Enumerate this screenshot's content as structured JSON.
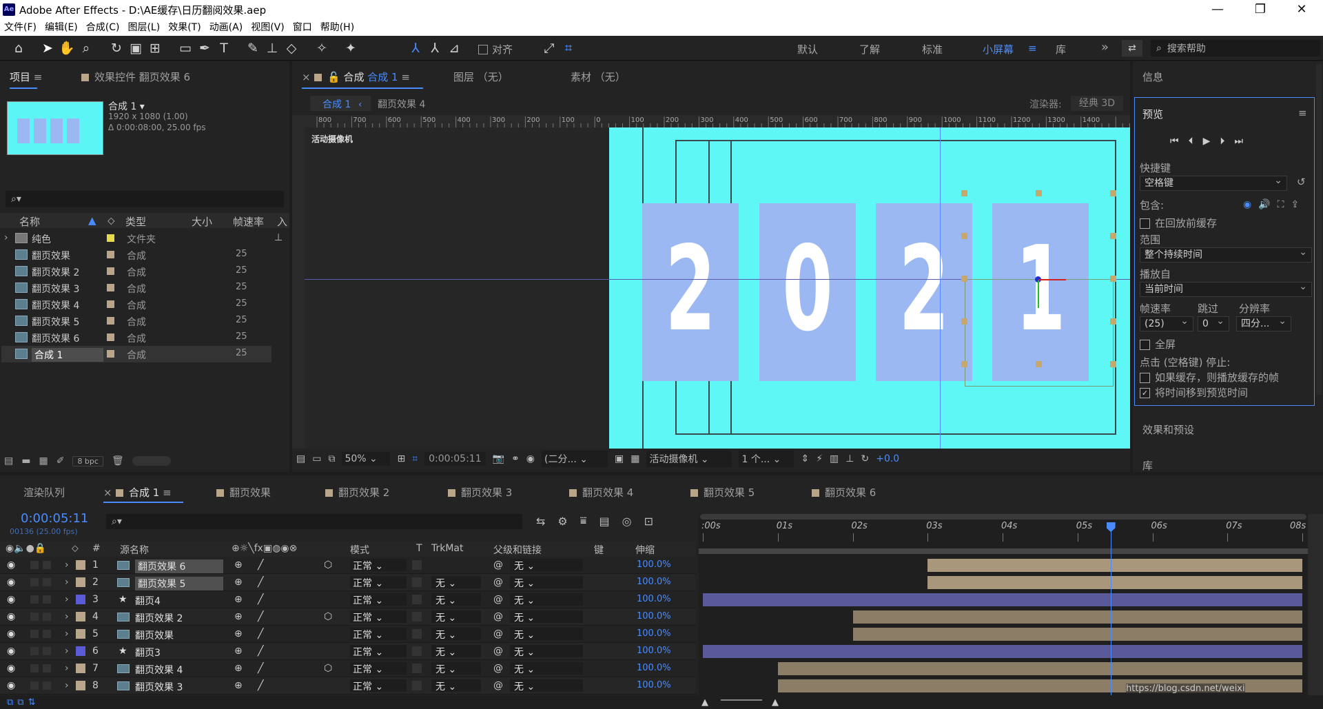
{
  "window": {
    "logo": "Ae",
    "title": "Adobe After Effects - D:\\AE缓存\\日历翻阅效果.aep",
    "minimize": "—",
    "maximize": "❐",
    "close": "✕"
  },
  "menu": [
    "文件(F)",
    "编辑(E)",
    "合成(C)",
    "图层(L)",
    "效果(T)",
    "动画(A)",
    "视图(V)",
    "窗口",
    "帮助(H)"
  ],
  "toolbar": {
    "align_label": "对齐",
    "workspaces": [
      "默认",
      "了解",
      "标准",
      "小屏幕",
      "库"
    ],
    "active_workspace": "小屏幕",
    "more": "»",
    "search_placeholder": "搜索帮助"
  },
  "project_panel": {
    "tab_project": "项目",
    "tab_effect_controls": "效果控件 翻页效果 6",
    "comp_name": "合成 1",
    "comp_info_1": "1920 x 1080 (1.00)",
    "comp_info_2": "Δ 0:00:08:00, 25.00 fps",
    "columns": [
      "名称",
      "类型",
      "大小",
      "帧速率",
      "入"
    ],
    "items": [
      {
        "name": "纯色",
        "type": "文件夹",
        "fps": ""
      },
      {
        "name": "翻页效果",
        "type": "合成",
        "fps": "25"
      },
      {
        "name": "翻页效果 2",
        "type": "合成",
        "fps": "25"
      },
      {
        "name": "翻页效果 3",
        "type": "合成",
        "fps": "25"
      },
      {
        "name": "翻页效果 4",
        "type": "合成",
        "fps": "25"
      },
      {
        "name": "翻页效果 5",
        "type": "合成",
        "fps": "25"
      },
      {
        "name": "翻页效果 6",
        "type": "合成",
        "fps": "25"
      },
      {
        "name": "合成 1",
        "type": "合成",
        "fps": "25"
      }
    ],
    "bpc": "8 bpc"
  },
  "viewer": {
    "tab_comp_prefix": "合成",
    "tab_comp_name": "合成 1",
    "tab_layer": "图层 （无）",
    "tab_footage": "素材 （无）",
    "breadcrumb_1": "合成 1",
    "breadcrumb_2": "翻页效果 4",
    "renderer_label": "渲染器:",
    "renderer_value": "经典 3D",
    "camera_label": "活动摄像机",
    "digits": [
      "2",
      "0",
      "2",
      "1"
    ],
    "ruler_marks": [
      "800",
      "700",
      "600",
      "500",
      "400",
      "300",
      "200",
      "100",
      "0",
      "100",
      "200",
      "300",
      "400",
      "500",
      "600",
      "700",
      "800",
      "900",
      "1000",
      "1100",
      "1200",
      "1300",
      "1400"
    ],
    "zoom": "50%",
    "timecode": "0:00:05:11",
    "resolution": "(二分...",
    "view": "活动摄像机",
    "views_count": "1 个...",
    "exposure": "+0.0"
  },
  "info_panel": {
    "tab_info": "信息",
    "tab_preview": "预览",
    "shortcut_label": "快捷键",
    "shortcut_value": "空格键",
    "include_label": "包含:",
    "cache_before": "在回放前缓存",
    "range_label": "范围",
    "range_value": "整个持续时间",
    "play_from_label": "播放自",
    "play_from_value": "当前时间",
    "fps_label": "帧速率",
    "skip_label": "跳过",
    "res_label": "分辨率",
    "fps_value": "(25)",
    "skip_value": "0",
    "res_value": "四分...",
    "fullscreen": "全屏",
    "stop_hint": "点击 (空格键) 停止:",
    "opt_cache": "如果缓存，则播放缓存的帧",
    "opt_move_time": "将时间移到预览时间",
    "tab_effects": "效果和预设",
    "tab_library": "库"
  },
  "timeline": {
    "tabs": [
      "渲染队列",
      "合成 1",
      "翻页效果",
      "翻页效果 2",
      "翻页效果 3",
      "翻页效果 4",
      "翻页效果 5",
      "翻页效果 6"
    ],
    "current_time": "0:00:05:11",
    "frame_info": "00136 (25.00 fps)",
    "columns": {
      "num": "#",
      "source": "源名称",
      "mode": "模式",
      "t": "T",
      "trkmat": "TrkMat",
      "parent": "父级和链接",
      "key": "键",
      "stretch": "伸缩"
    },
    "time_marks": [
      ":00s",
      "01s",
      "02s",
      "03s",
      "04s",
      "05s",
      "06s",
      "07s",
      "08s"
    ],
    "playhead_seconds": 5.44,
    "duration_seconds": 8,
    "layers": [
      {
        "num": "1",
        "name": "翻页效果 6",
        "kind": "comp",
        "label_color": "#b9a58a",
        "mode": "正常",
        "trkmat": "",
        "parent": "无",
        "stretch": "100.0%",
        "in": 3.0,
        "out": 8.0,
        "bar_color": "#a8977a"
      },
      {
        "num": "2",
        "name": "翻页效果 5",
        "kind": "comp",
        "label_color": "#b9a58a",
        "mode": "正常",
        "trkmat": "无",
        "parent": "无",
        "stretch": "100.0%",
        "in": 3.0,
        "out": 8.0,
        "bar_color": "#a8977a"
      },
      {
        "num": "3",
        "name": "翻页4",
        "kind": "light",
        "label_color": "#5b5bd8",
        "mode": "正常",
        "trkmat": "无",
        "parent": "无",
        "stretch": "100.0%",
        "in": 0.0,
        "out": 8.0,
        "bar_color": "#5a5a9a"
      },
      {
        "num": "4",
        "name": "翻页效果 2",
        "kind": "comp",
        "label_color": "#b9a58a",
        "mode": "正常",
        "trkmat": "无",
        "parent": "无",
        "stretch": "100.0%",
        "in": 2.0,
        "out": 8.0,
        "bar_color": "#8c7e66"
      },
      {
        "num": "5",
        "name": "翻页效果",
        "kind": "comp",
        "label_color": "#b9a58a",
        "mode": "正常",
        "trkmat": "无",
        "parent": "无",
        "stretch": "100.0%",
        "in": 2.0,
        "out": 8.0,
        "bar_color": "#8c7e66"
      },
      {
        "num": "6",
        "name": "翻页3",
        "kind": "light",
        "label_color": "#5b5bd8",
        "mode": "正常",
        "trkmat": "无",
        "parent": "无",
        "stretch": "100.0%",
        "in": 0.0,
        "out": 8.0,
        "bar_color": "#5a5a9a"
      },
      {
        "num": "7",
        "name": "翻页效果 4",
        "kind": "comp",
        "label_color": "#b9a58a",
        "mode": "正常",
        "trkmat": "无",
        "parent": "无",
        "stretch": "100.0%",
        "in": 1.0,
        "out": 8.0,
        "bar_color": "#8c7e66"
      },
      {
        "num": "8",
        "name": "翻页效果 3",
        "kind": "comp",
        "label_color": "#b9a58a",
        "mode": "正常",
        "trkmat": "无",
        "parent": "无",
        "stretch": "100.0%",
        "in": 1.0,
        "out": 8.0,
        "bar_color": "#8c7e66"
      }
    ],
    "watermark": "https://blog.csdn.net/weixi"
  }
}
